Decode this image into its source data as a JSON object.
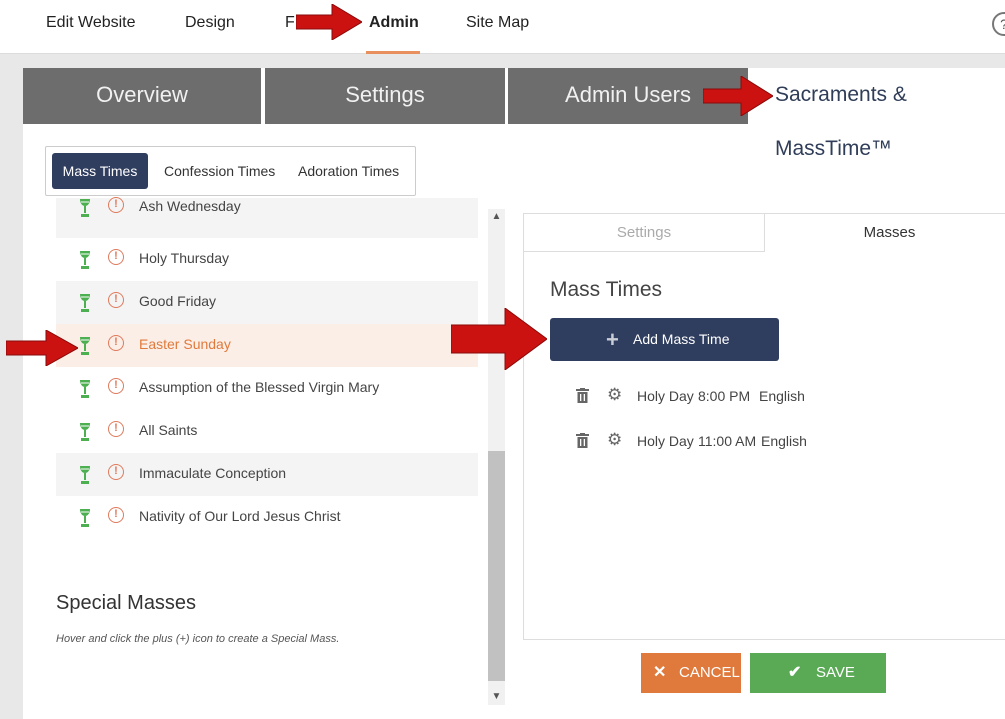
{
  "topnav": {
    "items": [
      "Edit Website",
      "Design",
      "F",
      "Admin",
      "Site Map"
    ],
    "active": "Admin",
    "help": "?"
  },
  "big_tabs": [
    "Overview",
    "Settings",
    "Admin Users",
    "Sacraments & MassTime™"
  ],
  "sub_tabs": [
    "Mass Times",
    "Confession Times",
    "Adoration Times"
  ],
  "holy_days": [
    "Ash Wednesday",
    "Holy Thursday",
    "Good Friday",
    "Easter Sunday",
    "Assumption of the Blessed Virgin Mary",
    "All Saints",
    "Immaculate Conception",
    "Nativity of Our Lord Jesus Christ"
  ],
  "warn_glyph": "!",
  "special": {
    "title": "Special Masses",
    "hint": "Hover and click the plus (+) icon to create a Special Mass."
  },
  "right": {
    "tabs": [
      "Settings",
      "Masses"
    ],
    "title": "Mass Times",
    "add_button": "Add Mass Time",
    "masses": [
      {
        "day": "Holy Day",
        "time": "8:00 PM",
        "lang": "English"
      },
      {
        "day": "Holy Day",
        "time": "11:00 AM",
        "lang": "English"
      }
    ]
  },
  "footer": {
    "cancel": "CANCEL",
    "save": "SAVE"
  },
  "colors": {
    "navy": "#2f3d5f",
    "orange": "#e07a3c",
    "green": "#5aaa55",
    "tab_gray": "#6d6d6d",
    "arrow_red": "#cc1111"
  }
}
